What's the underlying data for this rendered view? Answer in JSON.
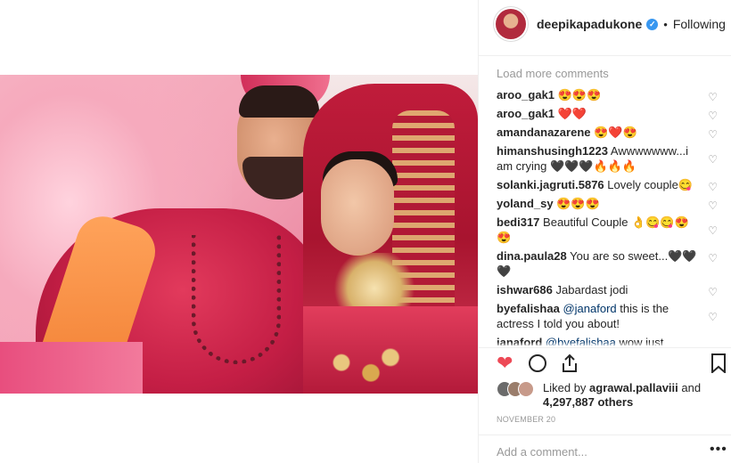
{
  "post": {
    "username": "deepikapadukone",
    "verified_icon": "verified-check-icon",
    "separator": "•",
    "follow_status": "Following"
  },
  "comments": {
    "load_more": "Load more comments",
    "items": [
      {
        "user": "aroo_gak1",
        "text": "😍😍😍"
      },
      {
        "user": "aroo_gak1",
        "text": "❤️❤️"
      },
      {
        "user": "amandanazarene",
        "text": "😍❤️😍"
      },
      {
        "user": "himanshusingh1223",
        "text": "Awwwwwww...i am crying 🖤🖤🖤🔥🔥🔥"
      },
      {
        "user": "solanki.jagruti.5876",
        "text": "Lovely couple😋"
      },
      {
        "user": "yoland_sy",
        "text": "😍😍😍"
      },
      {
        "user": "bedi317",
        "text": "Beautiful Couple 👌😋😋😍😍"
      },
      {
        "user": "dina.paula28",
        "text": "You are so sweet...🖤🖤🖤"
      },
      {
        "user": "ishwar686",
        "text": "Jabardast jodi"
      },
      {
        "user": "byefalishaa",
        "mention": "@janaford",
        "text": " this is the actress I told you about!"
      },
      {
        "user": "janaford",
        "mention": "@byefalishaa",
        "text": " wow just creeped on like all these pictures"
      }
    ]
  },
  "actions": {
    "like_icon": "heart-filled-icon",
    "comment_icon": "comment-bubble-icon",
    "share_icon": "share-icon",
    "save_icon": "bookmark-icon"
  },
  "likes": {
    "prefix": "Liked by ",
    "liker": "agrawal.pallaviii",
    "middle": " and",
    "count": "4,297,887 others"
  },
  "date": "NOVEMBER 20",
  "add_comment_placeholder": "Add a comment...",
  "more_options": "•••",
  "colors": {
    "like": "#ed4956",
    "link": "#003569",
    "muted": "#999999",
    "verified": "#3897f0"
  }
}
